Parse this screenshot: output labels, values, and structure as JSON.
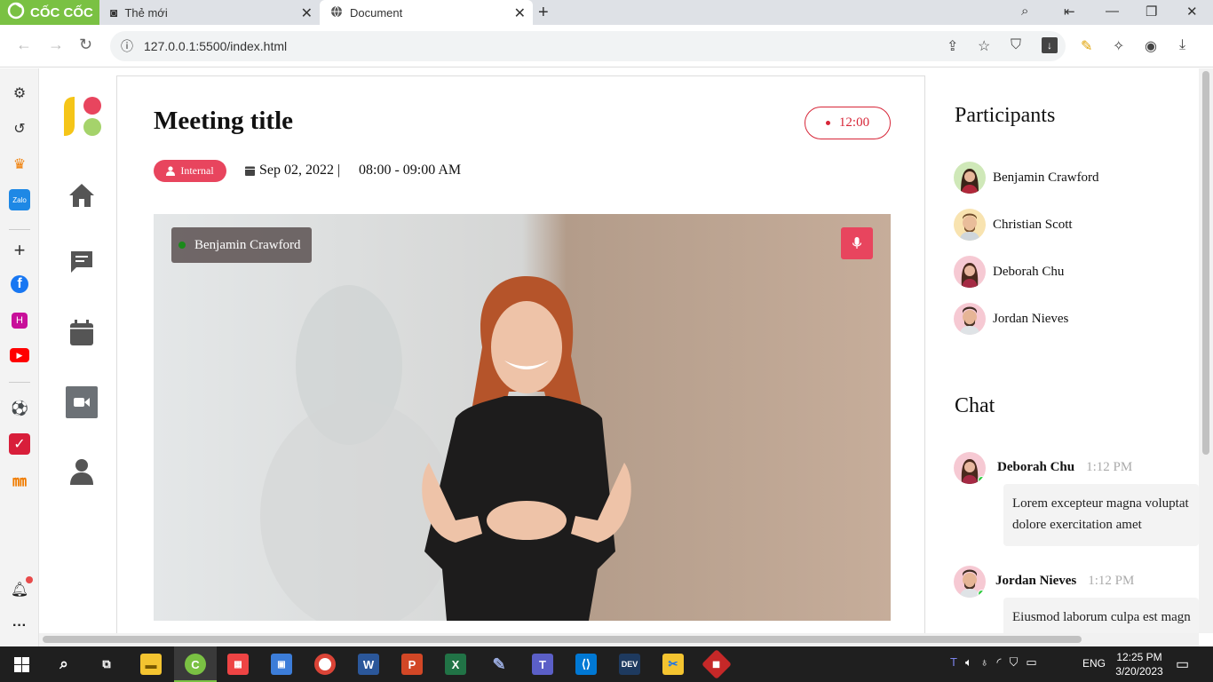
{
  "browser": {
    "brand_label": "CỐC CỐC",
    "tabs": [
      {
        "title": "Thẻ mới"
      },
      {
        "title": "Document"
      }
    ],
    "url": "127.0.0.1:5500/index.html"
  },
  "meeting": {
    "title": "Meeting title",
    "timer": "12:00",
    "badge": "Internal",
    "date": "Sep 02, 2022 |",
    "time_range": "08:00 - 09:00 AM",
    "speaker": "Benjamin Crawford"
  },
  "participants": {
    "heading": "Participants",
    "list": [
      {
        "name": "Benjamin Crawford"
      },
      {
        "name": "Christian Scott"
      },
      {
        "name": "Deborah Chu"
      },
      {
        "name": "Jordan Nieves"
      }
    ]
  },
  "chat": {
    "heading": "Chat",
    "messages": [
      {
        "name": "Deborah Chu",
        "time": "1:12 PM",
        "text": "Lorem excepteur magna voluptat dolore exercitation amet"
      },
      {
        "name": "Jordan Nieves",
        "time": "1:12 PM",
        "text": "Eiusmod laborum culpa est magn"
      }
    ]
  },
  "taskbar": {
    "clock_time": "12:25 PM",
    "clock_date": "3/20/2023",
    "lang": "ENG"
  },
  "colors": {
    "accent": "#e8455e",
    "timer": "#d72638",
    "brand": "#7ac143"
  }
}
